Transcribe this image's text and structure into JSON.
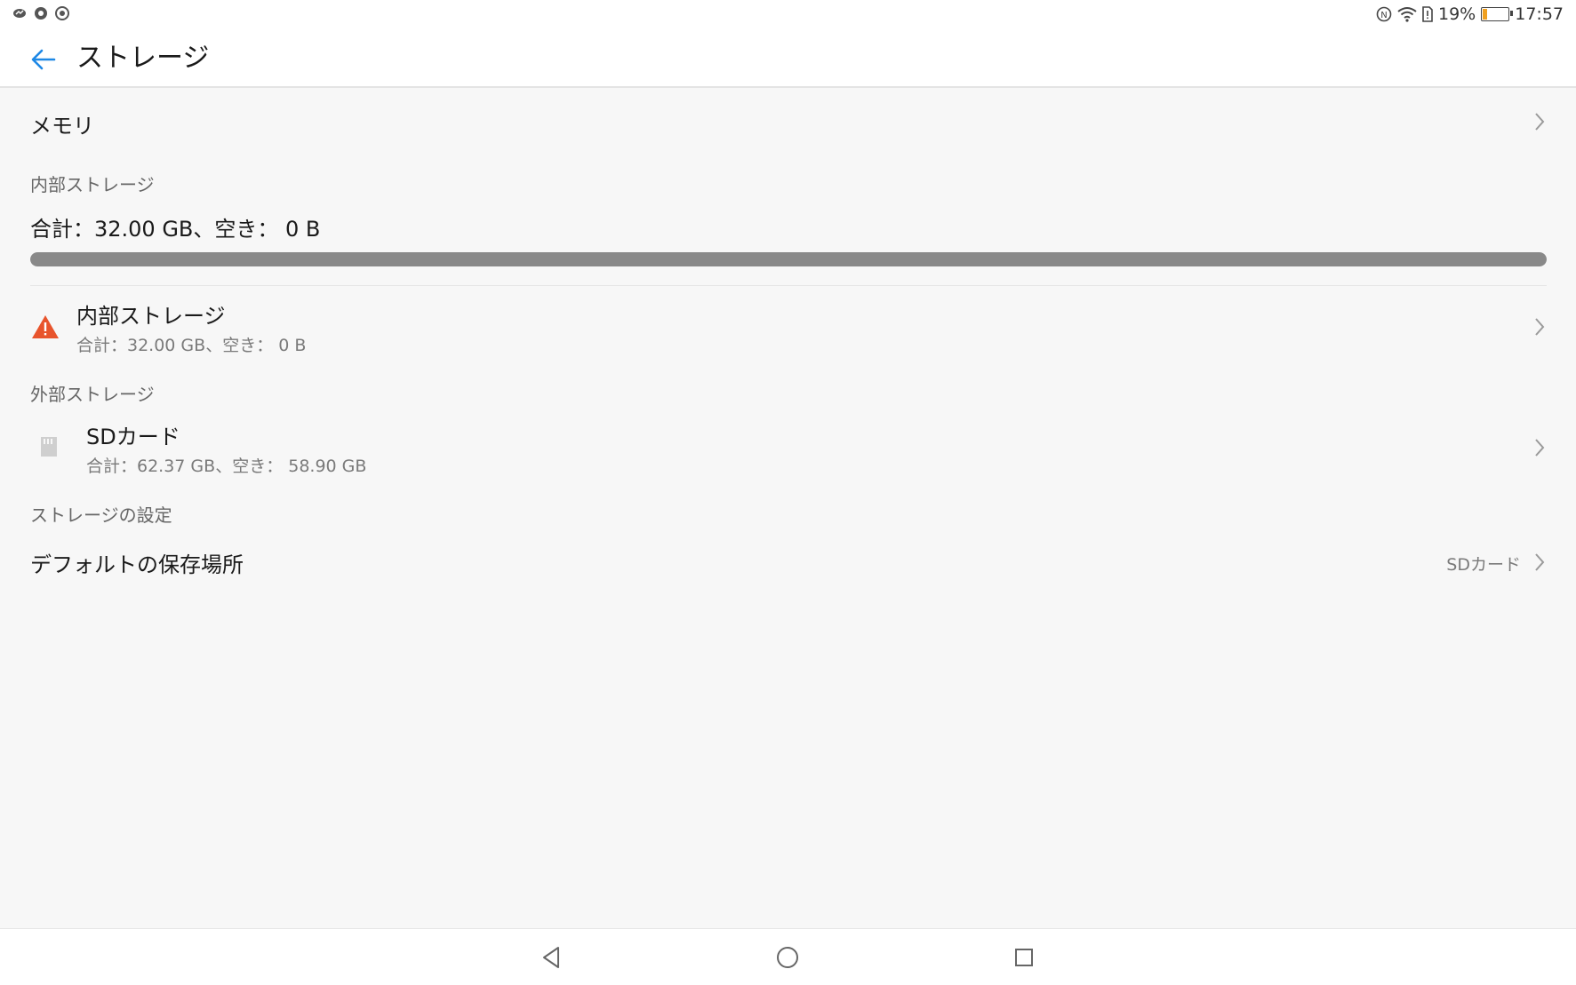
{
  "status_bar": {
    "left_icons": [
      "messenger-icon",
      "chrome-icon",
      "camera-notification-icon"
    ],
    "right_icons": [
      "nfc-icon",
      "wifi-icon",
      "sim-alert-icon",
      "battery-icon"
    ],
    "battery_percent": "19%",
    "battery_level": 0.19,
    "time": "17:57",
    "colors": {
      "battery_fill": "#f0a020"
    }
  },
  "header": {
    "back_icon": "back-arrow-icon",
    "title": "ストレージ",
    "colors": {
      "back_arrow": "#1e88e5"
    }
  },
  "memory_row": {
    "label": "メモリ"
  },
  "internal_section": {
    "heading": "内部ストレージ",
    "summary": "合計：32.00 GB、空き： 0 B",
    "usage_fraction": 1.0,
    "item": {
      "icon": "warning-icon",
      "title": "内部ストレージ",
      "subtitle": "合計：32.00 GB、空き： 0 B",
      "colors": {
        "warning": "#e8542c"
      }
    }
  },
  "external_section": {
    "heading": "外部ストレージ",
    "item": {
      "icon": "sd-card-icon",
      "title": "SDカード",
      "subtitle": "合計：62.37 GB、空き： 58.90 GB"
    }
  },
  "settings_section": {
    "heading": "ストレージの設定",
    "default_location": {
      "label": "デフォルトの保存場所",
      "value": "SDカード"
    }
  },
  "nav_bar": {
    "icons": [
      "nav-back-icon",
      "nav-home-icon",
      "nav-recents-icon"
    ]
  }
}
